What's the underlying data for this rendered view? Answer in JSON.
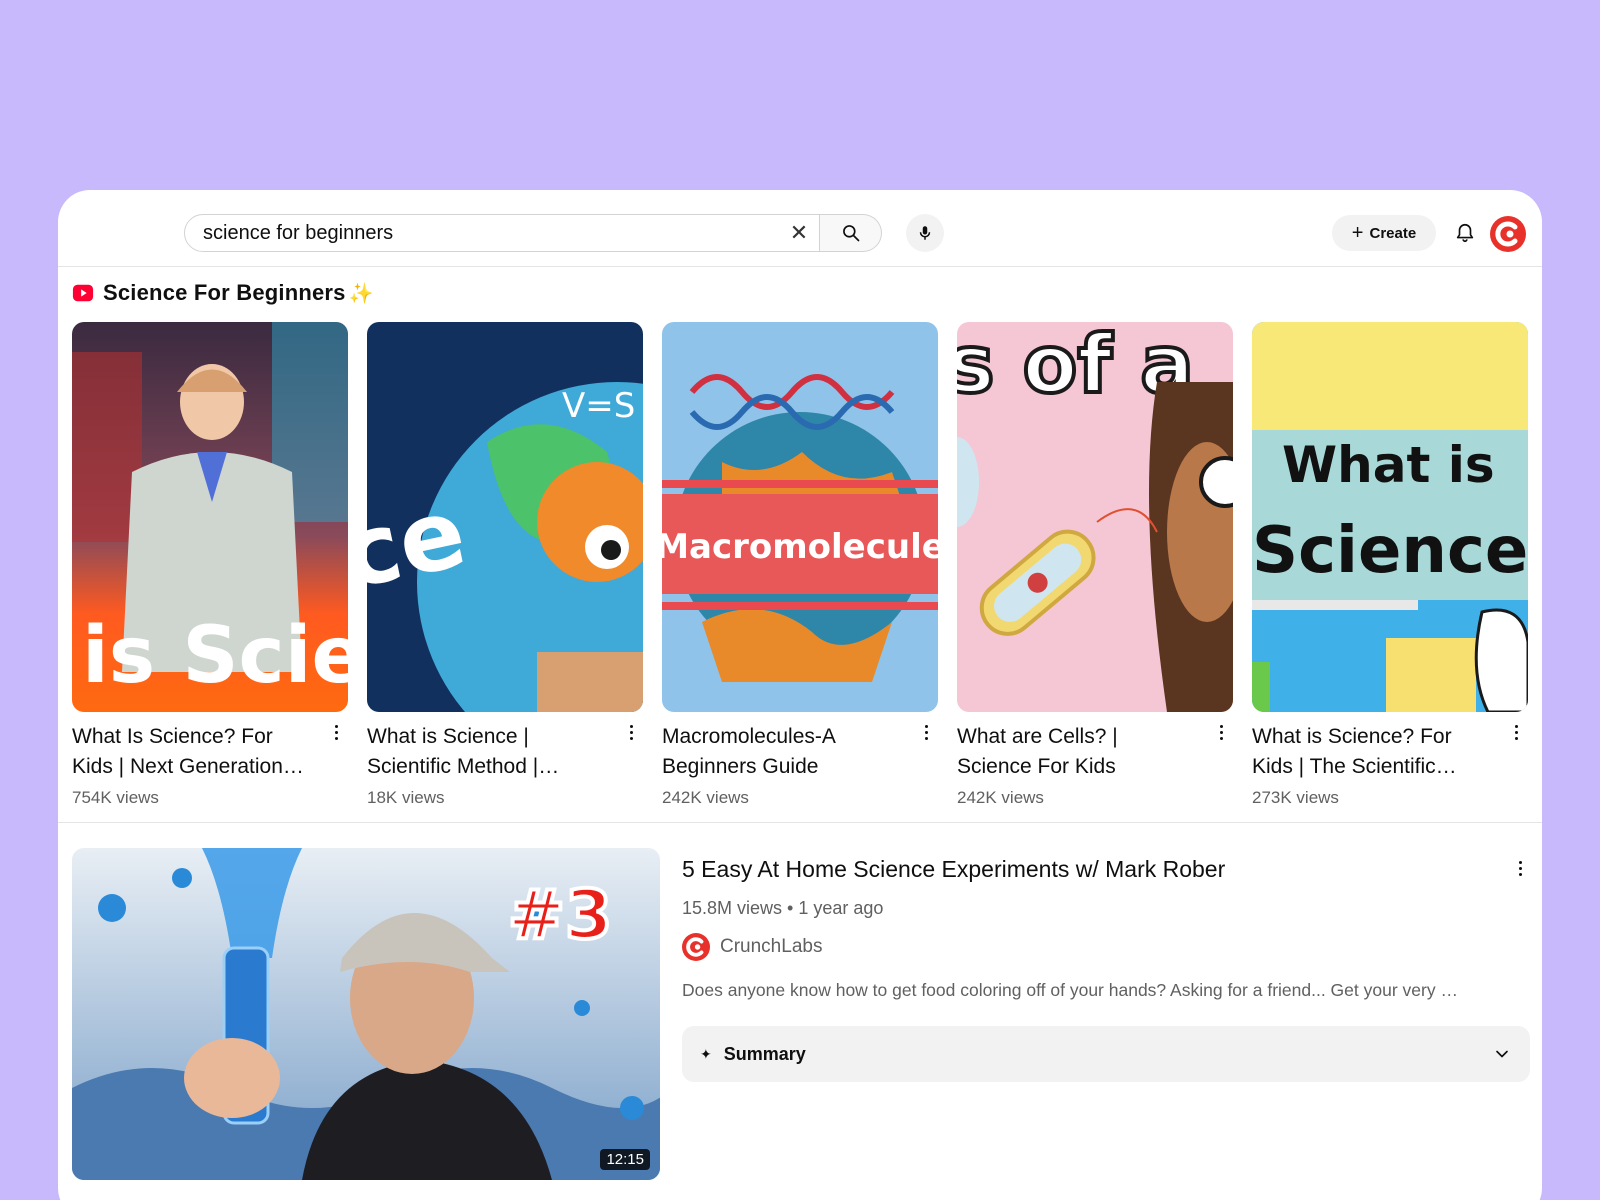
{
  "search": {
    "query": "science for beginners",
    "clear_icon": "close-icon",
    "search_icon": "search-icon",
    "mic_icon": "mic-icon"
  },
  "header": {
    "create_label": "Create",
    "bell_icon": "bell-icon",
    "accent": "#e8312a"
  },
  "shelf": {
    "title": "Science For Beginners",
    "sparkle": "✨",
    "items": [
      {
        "title": "What Is Science? For Kids | Next Generation…",
        "views": "754K views",
        "thumb_text": "is Scie"
      },
      {
        "title": "What is Science | Scientific Method |…",
        "views": "18K views",
        "thumb_text": "ce"
      },
      {
        "title": "Macromolecules-A Beginners Guide",
        "views": "242K views",
        "thumb_text": "Macromolecule"
      },
      {
        "title": "What are Cells? | Science For Kids",
        "views": "242K views",
        "thumb_text": "s of a"
      },
      {
        "title": "What is Science? For Kids | The Scientific…",
        "views": "273K views",
        "thumb_text_1": "What is",
        "thumb_text_2": "Science?"
      }
    ]
  },
  "featured": {
    "title": "5 Easy At Home Science Experiments w/ Mark Rober",
    "meta": "15.8M views • 1 year ago",
    "channel": "CrunchLabs",
    "description": "Does anyone know how to get food coloring off of your hands? Asking for a friend... Get your very …",
    "duration": "12:15",
    "badge": "#3",
    "summary_icon": "✦",
    "summary_label": "Summary"
  }
}
